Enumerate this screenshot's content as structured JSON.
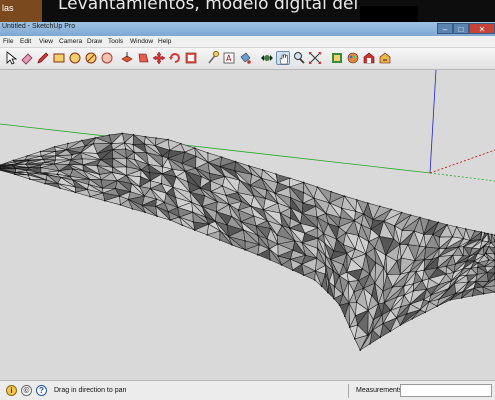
{
  "background": {
    "brand_fragment": "las",
    "headline": "Levantamientos, modelo digital del"
  },
  "window": {
    "title": "Untitled - SketchUp Pro"
  },
  "menu": [
    "File",
    "Edit",
    "View",
    "Camera",
    "Draw",
    "Tools",
    "Window",
    "Help"
  ],
  "toolbar": {
    "tools": [
      {
        "name": "select-tool-icon",
        "selected": false
      },
      {
        "name": "eraser-tool-icon",
        "selected": false
      },
      {
        "name": "pencil-line-tool-icon",
        "selected": false
      },
      {
        "name": "rectangle-tool-icon",
        "selected": false
      },
      {
        "name": "circle-tool-icon",
        "selected": false
      },
      {
        "name": "arc-tool-icon",
        "selected": false
      },
      {
        "name": "polygon-tool-icon",
        "selected": false
      },
      {
        "name": "push-pull-tool-icon",
        "selected": false
      },
      {
        "name": "move-tool-icon",
        "selected": false
      },
      {
        "name": "move-arrows-tool-icon",
        "selected": false
      },
      {
        "name": "rotate-tool-icon",
        "selected": false
      },
      {
        "name": "scale-tool-icon",
        "selected": false
      },
      {
        "name": "tape-measure-tool-icon",
        "selected": false
      },
      {
        "name": "text-tool-icon",
        "selected": false
      },
      {
        "name": "paint-bucket-tool-icon",
        "selected": false
      },
      {
        "name": "orbit-tool-icon",
        "selected": false
      },
      {
        "name": "pan-tool-icon",
        "selected": true
      },
      {
        "name": "zoom-tool-icon",
        "selected": false
      },
      {
        "name": "zoom-extents-tool-icon",
        "selected": false
      },
      {
        "name": "components-icon",
        "selected": false
      },
      {
        "name": "materials-icon",
        "selected": false
      },
      {
        "name": "warehouse-icon",
        "selected": false
      },
      {
        "name": "share-model-icon",
        "selected": false
      }
    ]
  },
  "status": {
    "hint": "Drag in direction to pan",
    "measurements_label": "Measurements",
    "measurements_value": ""
  },
  "colors": {
    "viewport_bg": "#d9d9d9",
    "terrain_light": "#c9c9c9",
    "terrain_dark": "#3d3d3d",
    "axis_red": "#cc0000",
    "axis_green": "#22aa22",
    "axis_blue": "#2222cc"
  }
}
